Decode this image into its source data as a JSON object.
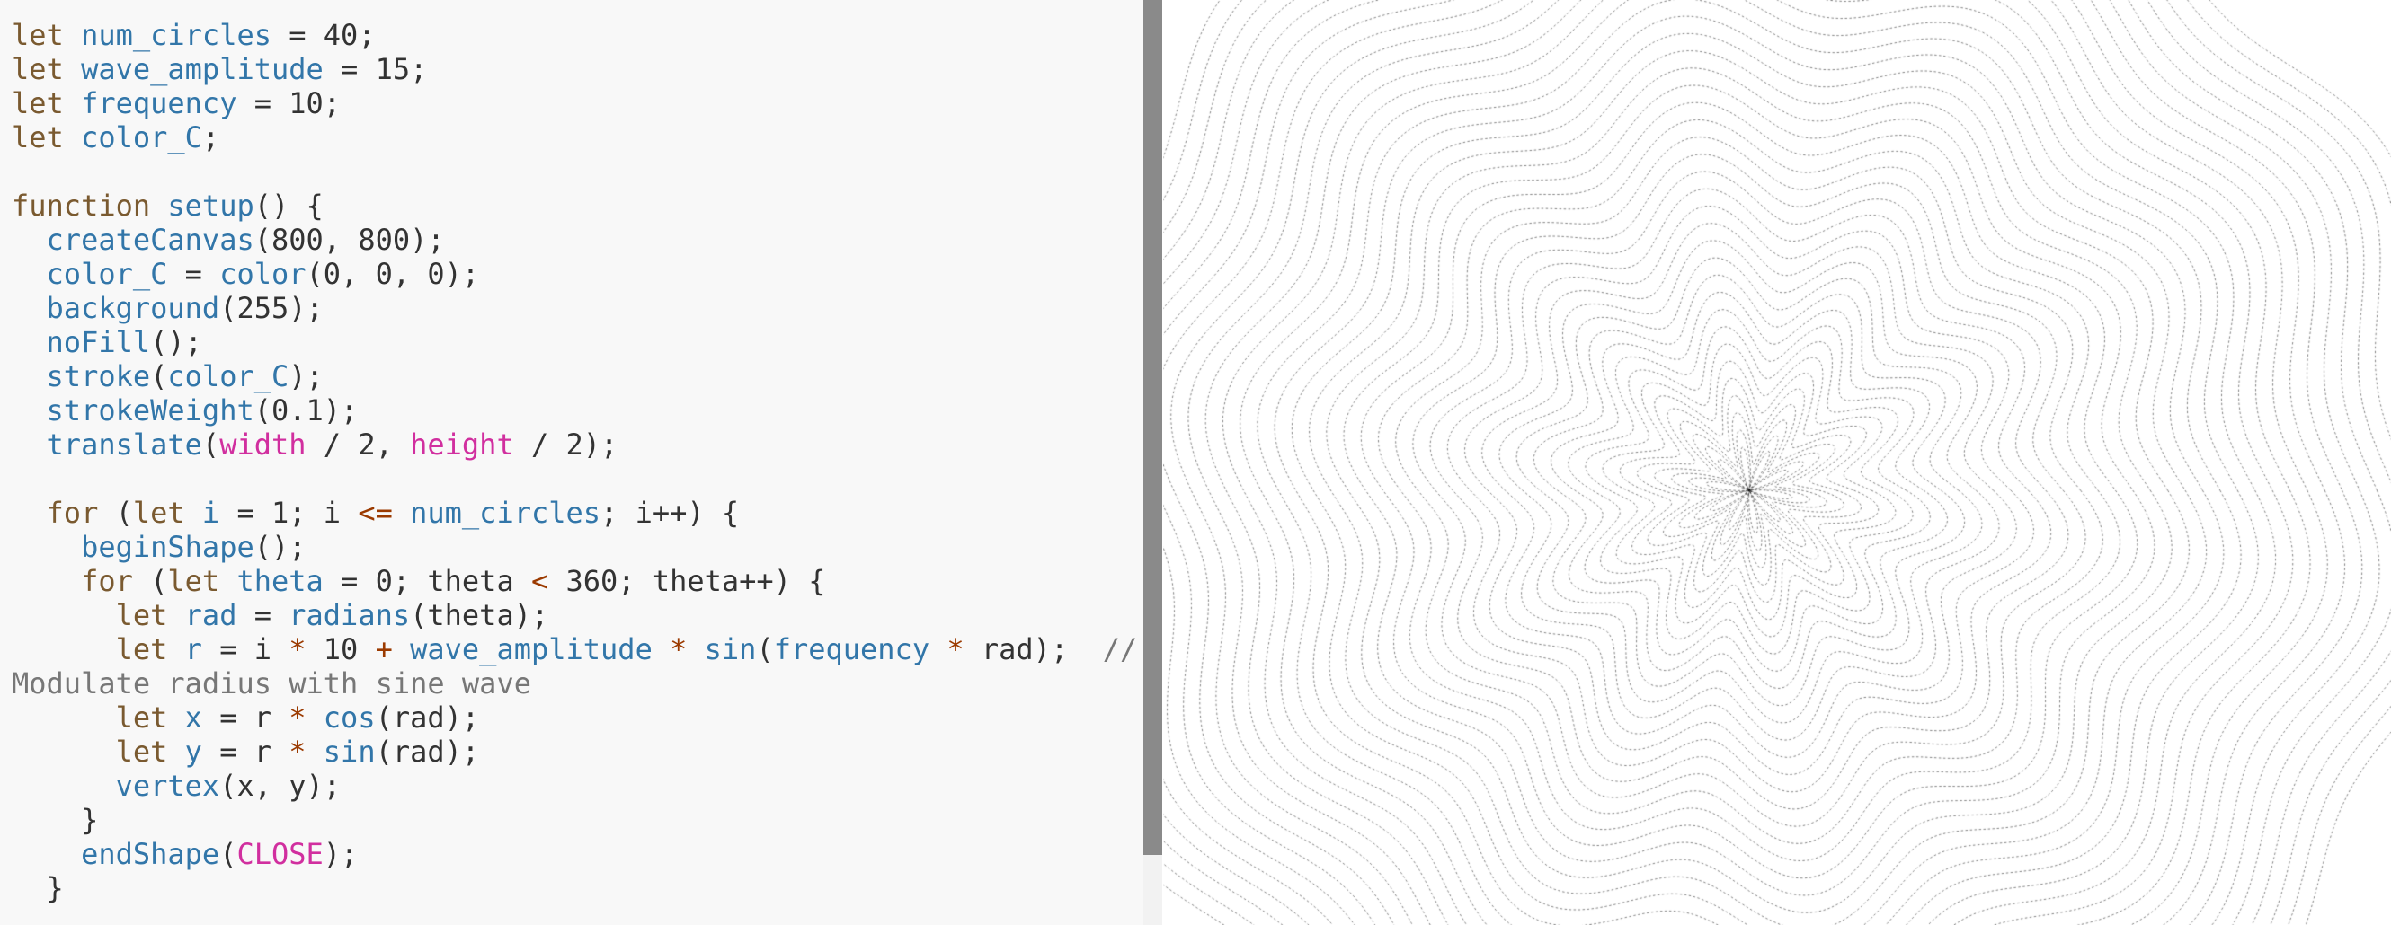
{
  "editor": {
    "lines": [
      [
        {
          "t": "k",
          "s": "let "
        },
        {
          "t": "v",
          "s": "num_circles"
        },
        {
          "t": "n",
          "s": " = 40;"
        }
      ],
      [
        {
          "t": "k",
          "s": "let "
        },
        {
          "t": "v",
          "s": "wave_amplitude"
        },
        {
          "t": "n",
          "s": " = 15;"
        }
      ],
      [
        {
          "t": "k",
          "s": "let "
        },
        {
          "t": "v",
          "s": "frequency"
        },
        {
          "t": "n",
          "s": " = 10;"
        }
      ],
      [
        {
          "t": "k",
          "s": "let "
        },
        {
          "t": "v",
          "s": "color_C"
        },
        {
          "t": "n",
          "s": ";"
        }
      ],
      [
        {
          "t": "n",
          "s": ""
        }
      ],
      [
        {
          "t": "k",
          "s": "function "
        },
        {
          "t": "v",
          "s": "setup"
        },
        {
          "t": "n",
          "s": "() {"
        }
      ],
      [
        {
          "t": "n",
          "s": "  "
        },
        {
          "t": "v",
          "s": "createCanvas"
        },
        {
          "t": "n",
          "s": "(800, 800);"
        }
      ],
      [
        {
          "t": "n",
          "s": "  "
        },
        {
          "t": "v",
          "s": "color_C"
        },
        {
          "t": "n",
          "s": " = "
        },
        {
          "t": "v",
          "s": "color"
        },
        {
          "t": "n",
          "s": "(0, 0, 0);"
        }
      ],
      [
        {
          "t": "n",
          "s": "  "
        },
        {
          "t": "v",
          "s": "background"
        },
        {
          "t": "n",
          "s": "(255);"
        }
      ],
      [
        {
          "t": "n",
          "s": "  "
        },
        {
          "t": "v",
          "s": "noFill"
        },
        {
          "t": "n",
          "s": "();"
        }
      ],
      [
        {
          "t": "n",
          "s": "  "
        },
        {
          "t": "v",
          "s": "stroke"
        },
        {
          "t": "n",
          "s": "("
        },
        {
          "t": "v",
          "s": "color_C"
        },
        {
          "t": "n",
          "s": ");"
        }
      ],
      [
        {
          "t": "n",
          "s": "  "
        },
        {
          "t": "v",
          "s": "strokeWeight"
        },
        {
          "t": "n",
          "s": "(0.1);"
        }
      ],
      [
        {
          "t": "n",
          "s": "  "
        },
        {
          "t": "v",
          "s": "translate"
        },
        {
          "t": "n",
          "s": "("
        },
        {
          "t": "p",
          "s": "width"
        },
        {
          "t": "n",
          "s": " / 2, "
        },
        {
          "t": "p",
          "s": "height"
        },
        {
          "t": "n",
          "s": " / 2);"
        }
      ],
      [
        {
          "t": "n",
          "s": ""
        }
      ],
      [
        {
          "t": "n",
          "s": "  "
        },
        {
          "t": "k",
          "s": "for"
        },
        {
          "t": "n",
          "s": " ("
        },
        {
          "t": "k",
          "s": "let "
        },
        {
          "t": "v",
          "s": "i"
        },
        {
          "t": "n",
          "s": " = 1; i "
        },
        {
          "t": "o",
          "s": "<="
        },
        {
          "t": "n",
          "s": " "
        },
        {
          "t": "v",
          "s": "num_circles"
        },
        {
          "t": "n",
          "s": "; i++) {"
        }
      ],
      [
        {
          "t": "n",
          "s": "    "
        },
        {
          "t": "v",
          "s": "beginShape"
        },
        {
          "t": "n",
          "s": "();"
        }
      ],
      [
        {
          "t": "n",
          "s": "    "
        },
        {
          "t": "k",
          "s": "for"
        },
        {
          "t": "n",
          "s": " ("
        },
        {
          "t": "k",
          "s": "let "
        },
        {
          "t": "v",
          "s": "theta"
        },
        {
          "t": "n",
          "s": " = 0; theta "
        },
        {
          "t": "o",
          "s": "<"
        },
        {
          "t": "n",
          "s": " 360; theta++) {"
        }
      ],
      [
        {
          "t": "n",
          "s": "      "
        },
        {
          "t": "k",
          "s": "let "
        },
        {
          "t": "v",
          "s": "rad"
        },
        {
          "t": "n",
          "s": " = "
        },
        {
          "t": "v",
          "s": "radians"
        },
        {
          "t": "n",
          "s": "(theta);"
        }
      ],
      [
        {
          "t": "n",
          "s": "      "
        },
        {
          "t": "k",
          "s": "let "
        },
        {
          "t": "v",
          "s": "r"
        },
        {
          "t": "n",
          "s": " = i "
        },
        {
          "t": "o",
          "s": "*"
        },
        {
          "t": "n",
          "s": " 10 "
        },
        {
          "t": "o",
          "s": "+"
        },
        {
          "t": "n",
          "s": " "
        },
        {
          "t": "v",
          "s": "wave_amplitude"
        },
        {
          "t": "n",
          "s": " "
        },
        {
          "t": "o",
          "s": "*"
        },
        {
          "t": "n",
          "s": " "
        },
        {
          "t": "v",
          "s": "sin"
        },
        {
          "t": "n",
          "s": "("
        },
        {
          "t": "v",
          "s": "frequency"
        },
        {
          "t": "n",
          "s": " "
        },
        {
          "t": "o",
          "s": "*"
        },
        {
          "t": "n",
          "s": " rad);  "
        },
        {
          "t": "c",
          "s": "//"
        }
      ],
      [
        {
          "t": "c",
          "s": "Modulate radius with sine wave"
        }
      ],
      [
        {
          "t": "n",
          "s": "      "
        },
        {
          "t": "k",
          "s": "let "
        },
        {
          "t": "v",
          "s": "x"
        },
        {
          "t": "n",
          "s": " = r "
        },
        {
          "t": "o",
          "s": "*"
        },
        {
          "t": "n",
          "s": " "
        },
        {
          "t": "v",
          "s": "cos"
        },
        {
          "t": "n",
          "s": "(rad);"
        }
      ],
      [
        {
          "t": "n",
          "s": "      "
        },
        {
          "t": "k",
          "s": "let "
        },
        {
          "t": "v",
          "s": "y"
        },
        {
          "t": "n",
          "s": " = r "
        },
        {
          "t": "o",
          "s": "*"
        },
        {
          "t": "n",
          "s": " "
        },
        {
          "t": "v",
          "s": "sin"
        },
        {
          "t": "n",
          "s": "(rad);"
        }
      ],
      [
        {
          "t": "n",
          "s": "      "
        },
        {
          "t": "v",
          "s": "vertex"
        },
        {
          "t": "n",
          "s": "(x, y);"
        }
      ],
      [
        {
          "t": "n",
          "s": "    }"
        }
      ],
      [
        {
          "t": "n",
          "s": "    "
        },
        {
          "t": "v",
          "s": "endShape"
        },
        {
          "t": "n",
          "s": "("
        },
        {
          "t": "p",
          "s": "CLOSE"
        },
        {
          "t": "n",
          "s": ");"
        }
      ],
      [
        {
          "t": "n",
          "s": "  }"
        }
      ]
    ]
  },
  "sketch": {
    "num_circles": 40,
    "wave_amplitude": 15,
    "frequency": 10,
    "stroke_color": "#000000",
    "background_color": "#ffffff"
  },
  "colors": {
    "editor_bg": "#f8f8f8",
    "keyword": "#7a5a30",
    "identifier": "#3276a9",
    "constant": "#d12f9f",
    "comment": "#777777",
    "scrollbar": "#8a8a8a"
  }
}
